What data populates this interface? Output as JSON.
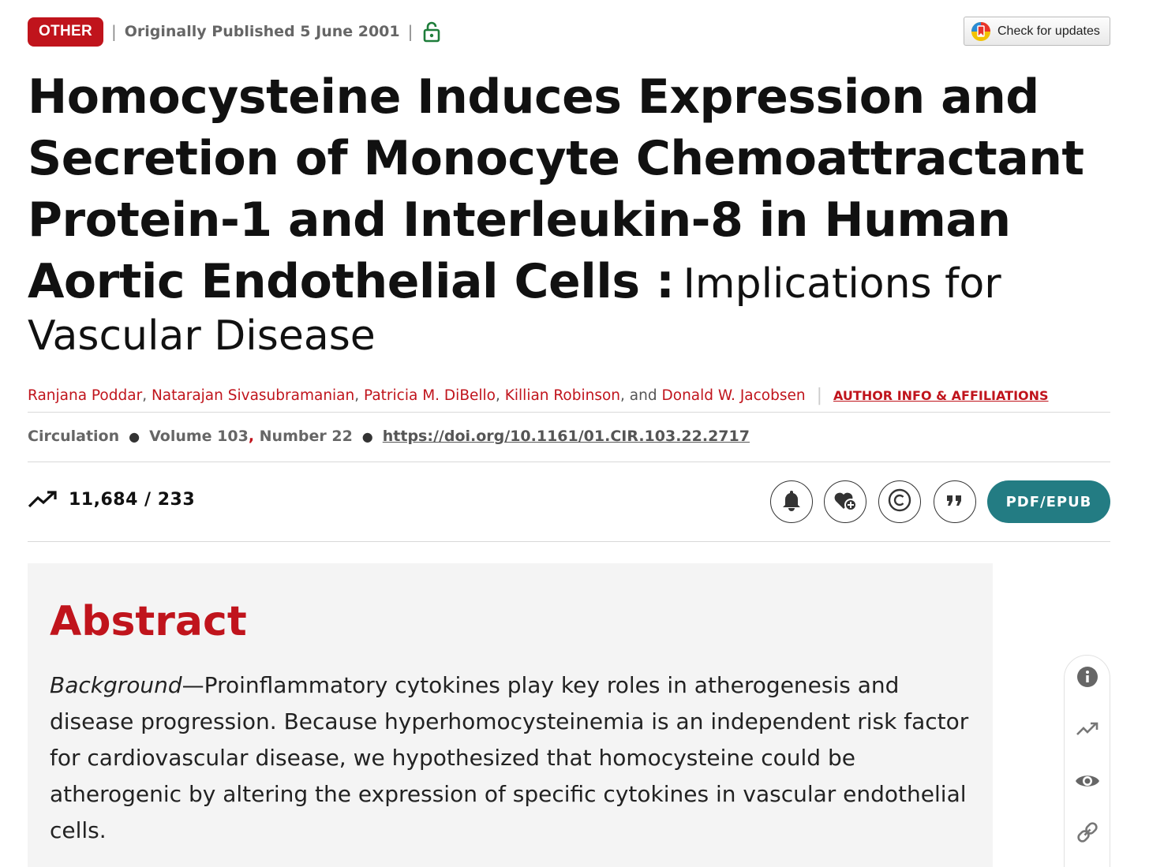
{
  "header": {
    "badge": "OTHER",
    "published": "Originally Published 5 June 2001",
    "check_updates": "Check for updates"
  },
  "article": {
    "title_main": "Homocysteine Induces Expression and Secretion of Monocyte Chemoattractant Protein-1 and Interleukin-8 in Human Aortic Endothelial Cells :",
    "title_sub": "Implications for Vascular Disease",
    "authors": [
      "Ranjana Poddar",
      "Natarajan Sivasubramanian",
      "Patricia M. DiBello",
      "Killian Robinson",
      "Donald W. Jacobsen"
    ],
    "author_joiner": ", and",
    "author_info_link": "AUTHOR INFO & AFFILIATIONS"
  },
  "citation": {
    "journal": "Circulation",
    "volume": "Volume 103",
    "number": "Number 22",
    "doi": "https://doi.org/10.1161/01.CIR.103.22.2717"
  },
  "metrics": {
    "counts": "11,684 / 233"
  },
  "actions": {
    "pdf_label": "PDF/EPUB",
    "icons": [
      "bell-icon",
      "heart-plus-icon",
      "copyright-icon",
      "quote-icon"
    ]
  },
  "abstract": {
    "heading": "Abstract",
    "background_label": "Background",
    "background_text": "—Proinflammatory cytokines play key roles in atherogenesis and disease progression. Because hyperhomocysteinemia is an independent risk factor for cardiovascular disease, we hypothesized that homocysteine could be atherogenic by altering the expression of specific cytokines in vascular endothelial cells."
  },
  "side_rail": {
    "icons": [
      "info-icon",
      "trending-icon",
      "eye-icon",
      "link-icon"
    ]
  },
  "colors": {
    "accent_red": "#c0141c",
    "teal": "#237c83",
    "open_access_green": "#1e7d3a"
  }
}
